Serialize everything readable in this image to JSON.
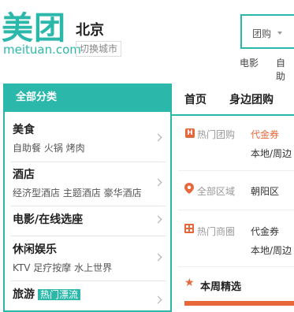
{
  "logo": {
    "name": "美团",
    "url": "meituan.com"
  },
  "city": {
    "name": "北京",
    "switch_label": "切换城市"
  },
  "search": {
    "type_label": "团购",
    "hot_words": [
      "电影",
      "自助"
    ]
  },
  "sidebar": {
    "header": "全部分类",
    "categories": [
      {
        "title": "美食",
        "sub": "自助餐 火锅 烤肉"
      },
      {
        "title": "酒店",
        "sub": "经济型酒店 主题酒店 豪华酒店"
      },
      {
        "title": "电影/在线选座",
        "sub": ""
      },
      {
        "title": "休闲娱乐",
        "sub": "KTV 足疗按摩 水上世界"
      },
      {
        "title": "旅游",
        "tag": "热门漂流"
      }
    ]
  },
  "nav": {
    "home": "首页",
    "nearby": "身边团购"
  },
  "filters": {
    "hot_deals_label": "热门团购",
    "hot_deals_value": "代金券",
    "hot_deals_sub": "本地/周边",
    "all_areas_label": "全部区域",
    "all_areas_value": "朝阳区",
    "hot_districts_label": "热门商圈",
    "hot_districts_value": "代金券",
    "hot_districts_sub": "本地/周边"
  },
  "weekly": {
    "title": "本周精选"
  },
  "colors": {
    "brand": "#2bb8aa",
    "accent": "#e8673a"
  }
}
